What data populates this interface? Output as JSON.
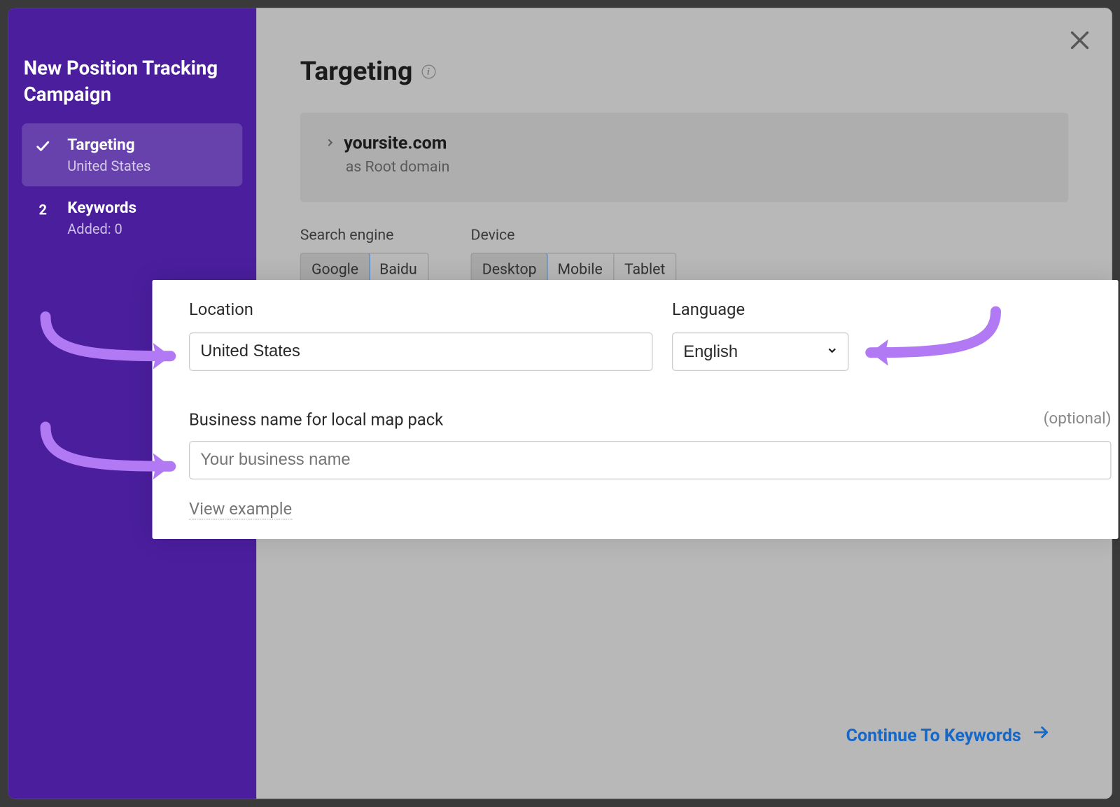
{
  "sidebar": {
    "title": "New Position Tracking Campaign",
    "steps": [
      {
        "label": "Targeting",
        "subtext": "United States"
      },
      {
        "label": "Keywords",
        "subtext": "Added: 0",
        "number": "2"
      }
    ]
  },
  "header": {
    "title": "Targeting"
  },
  "domain": {
    "name": "yoursite.com",
    "subtext": "as Root domain"
  },
  "search_engine": {
    "label": "Search engine",
    "options": [
      "Google",
      "Baidu"
    ]
  },
  "device": {
    "label": "Device",
    "options": [
      "Desktop",
      "Mobile",
      "Tablet"
    ]
  },
  "location": {
    "label": "Location",
    "value": "United States"
  },
  "language": {
    "label": "Language",
    "value": "English"
  },
  "business": {
    "label": "Business name for local map pack",
    "optional": "(optional)",
    "placeholder": "Your business name",
    "view_example": "View example"
  },
  "continue_label": "Continue To Keywords"
}
